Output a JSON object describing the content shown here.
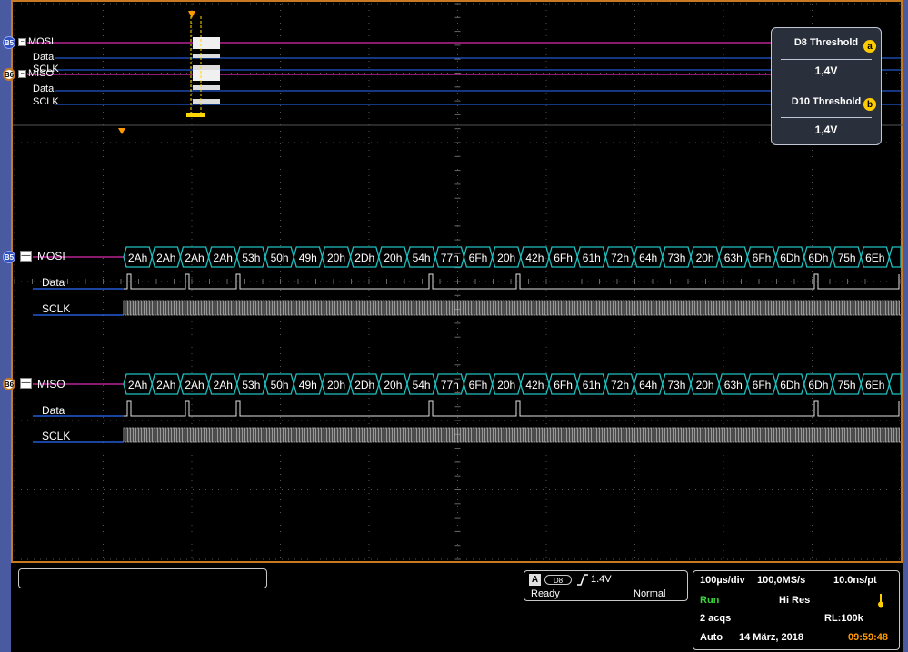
{
  "colors": {
    "frame": "#c87a22",
    "bus_teal": "#20c0c0",
    "bus_purple": "#8a1a6e",
    "trace_white": "#e0e0e0",
    "trace_blue": "#2a6cff",
    "run_green": "#3dd23d",
    "clock_orange": "#ff9900"
  },
  "overview": {
    "bus1": {
      "badge": "B5",
      "name": "MOSI",
      "data": "Data",
      "sclk": "SCLK"
    },
    "bus2": {
      "badge": "B6",
      "name": "MISO",
      "data": "Data",
      "sclk": "SCLK"
    }
  },
  "threshold_panel": {
    "d8_title": "D8 Threshold",
    "d8_badge": "a",
    "d8_value": "1,4V",
    "d10_title": "D10 Threshold",
    "d10_badge": "b",
    "d10_value": "1,4V"
  },
  "decode": {
    "mosi": {
      "badge": "B5",
      "name": "MOSI",
      "data": "Data",
      "sclk": "SCLK"
    },
    "miso": {
      "badge": "B6",
      "name": "MISO",
      "data": "Data",
      "sclk": "SCLK"
    },
    "packets": [
      "2Ah",
      "2Ah",
      "2Ah",
      "2Ah",
      "53h",
      "50h",
      "49h",
      "20h",
      "2Dh",
      "20h",
      "54h",
      "77h",
      "6Fh",
      "20h",
      "42h",
      "6Fh",
      "61h",
      "72h",
      "64h",
      "73h",
      "20h",
      "63h",
      "6Fh",
      "6Dh",
      "6Dh",
      "75h",
      "6Eh"
    ]
  },
  "trigger": {
    "source_letter": "A",
    "source_channel": "D8",
    "level": "1.4V",
    "state": "Ready",
    "mode": "Normal"
  },
  "acquisition": {
    "timebase": "100µs/div",
    "sample_rate": "100,0MS/s",
    "resolution": "10.0ns/pt",
    "run_state": "Run",
    "acq_mode": "Hi Res",
    "acqs": "2 acqs",
    "record_length": "RL:100k",
    "auto": "Auto",
    "date": "14 März, 2018",
    "time": "09:59:48"
  }
}
